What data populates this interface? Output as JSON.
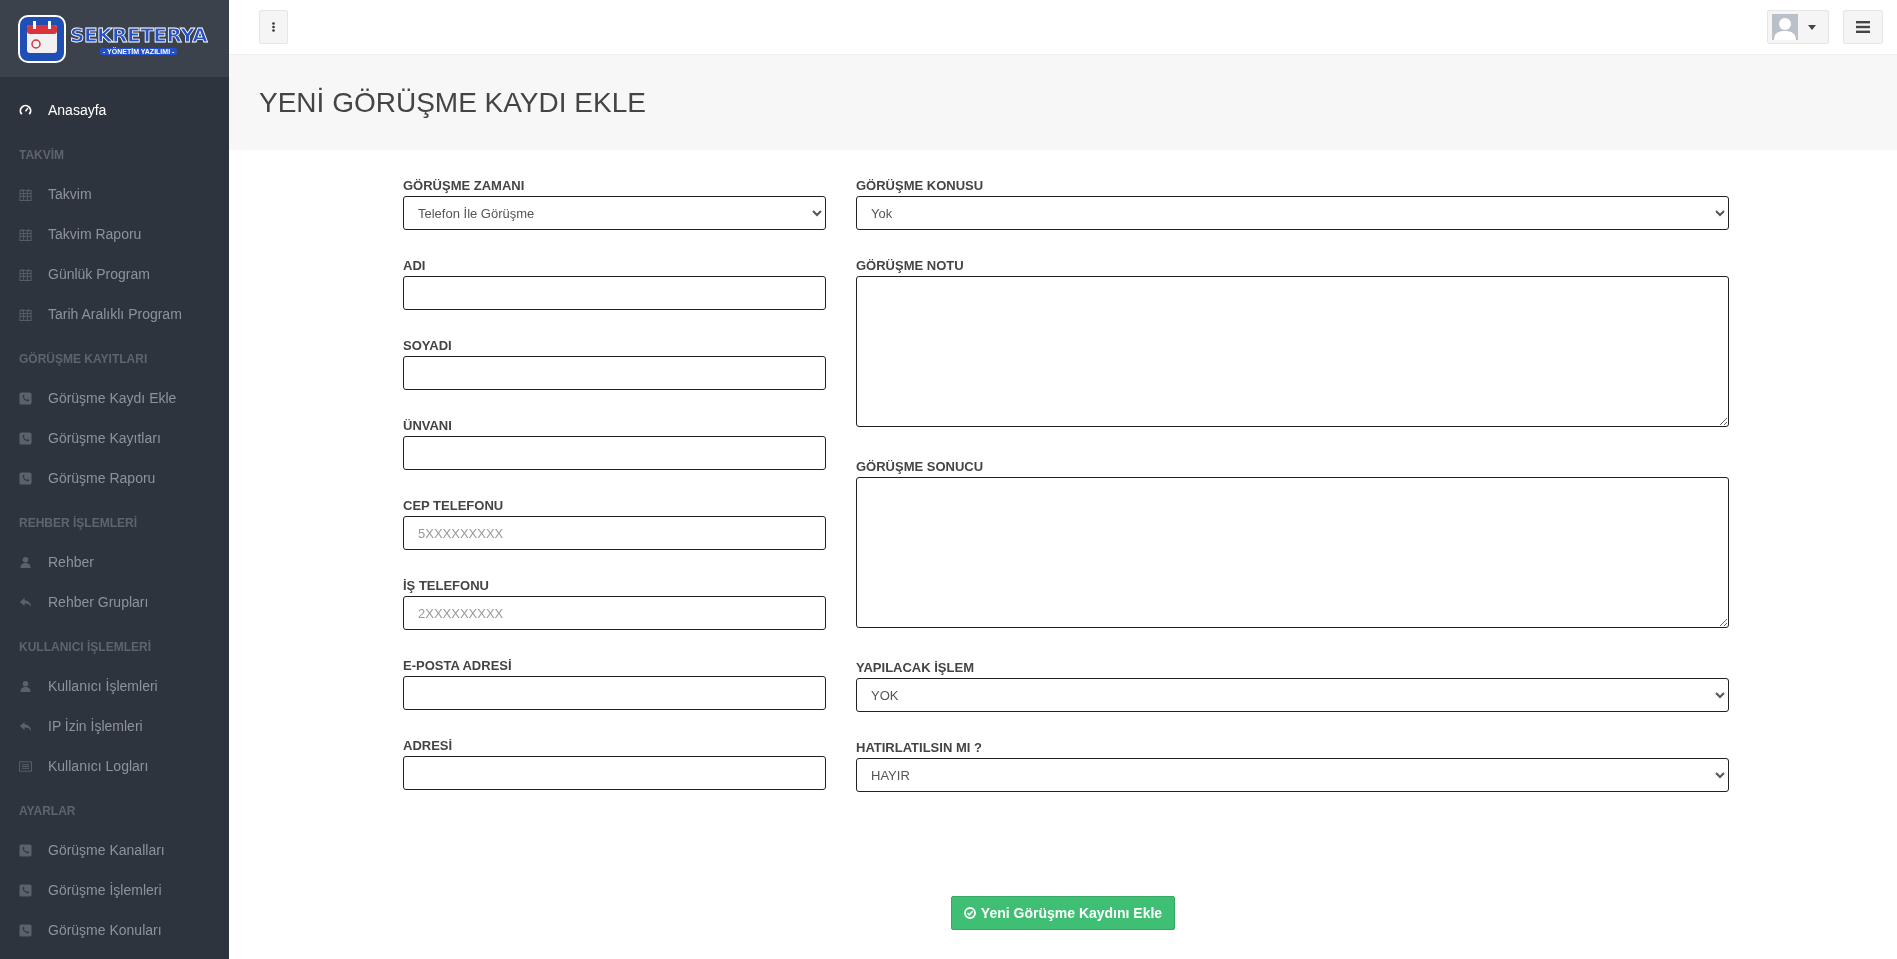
{
  "sidebar": {
    "logo": {
      "title": "SEKRETERYA",
      "subtitle": "- YÖNETİM YAZILIMI -"
    },
    "items": [
      {
        "kind": "dashboard",
        "label": "Anasayfa",
        "selected": true
      },
      {
        "kind": "heading",
        "label": "TAKVİM"
      },
      {
        "kind": "calendar",
        "label": "Takvim",
        "selected": false
      },
      {
        "kind": "calendar",
        "label": "Takvim Raporu",
        "selected": false
      },
      {
        "kind": "calendar",
        "label": "Günlük Program",
        "selected": false
      },
      {
        "kind": "calendar",
        "label": "Tarih Aralıklı Program",
        "selected": false
      },
      {
        "kind": "heading",
        "label": "GÖRÜŞME KAYITLARI"
      },
      {
        "kind": "call",
        "label": "Görüşme Kaydı Ekle",
        "selected": false
      },
      {
        "kind": "call",
        "label": "Görüşme Kayıtları",
        "selected": false
      },
      {
        "kind": "call",
        "label": "Görüşme Raporu",
        "selected": false
      },
      {
        "kind": "heading",
        "label": "REHBER İŞLEMLERİ"
      },
      {
        "kind": "contact",
        "label": "Rehber",
        "selected": false
      },
      {
        "kind": "share",
        "label": "Rehber Grupları",
        "selected": false
      },
      {
        "kind": "heading",
        "label": "KULLANICI İŞLEMLERİ"
      },
      {
        "kind": "contact",
        "label": "Kullanıcı İşlemleri",
        "selected": false
      },
      {
        "kind": "share",
        "label": "IP İzin İşlemleri",
        "selected": false
      },
      {
        "kind": "log",
        "label": "Kullanıcı Logları",
        "selected": false
      },
      {
        "kind": "heading",
        "label": "AYARLAR"
      },
      {
        "kind": "call",
        "label": "Görüşme Kanalları",
        "selected": false
      },
      {
        "kind": "call",
        "label": "Görüşme İşlemleri",
        "selected": false
      },
      {
        "kind": "call",
        "label": "Görüşme Konuları",
        "selected": false
      }
    ]
  },
  "page_title": "YENİ GÖRÜŞME KAYDI EKLE",
  "form": {
    "left": [
      {
        "label": "GÖRÜŞME ZAMANI",
        "kind": "select",
        "value": "Telefon İle Görüşme"
      },
      {
        "label": "ADI",
        "kind": "input"
      },
      {
        "label": "SOYADI",
        "kind": "input"
      },
      {
        "label": "ÜNVANI",
        "kind": "input"
      },
      {
        "label": "CEP TELEFONU",
        "kind": "input",
        "placeholder": "5XXXXXXXXX"
      },
      {
        "label": "İŞ TELEFONU",
        "kind": "input",
        "placeholder": "2XXXXXXXXX"
      },
      {
        "label": "E-POSTA ADRESİ",
        "kind": "input"
      },
      {
        "label": "ADRESİ",
        "kind": "input"
      }
    ],
    "right": [
      {
        "label": "GÖRÜŞME KONUSU",
        "kind": "select",
        "value": "Yok"
      },
      {
        "label": "GÖRÜŞME NOTU",
        "kind": "textarea"
      },
      {
        "label": "GÖRÜŞME SONUCU",
        "kind": "textarea"
      },
      {
        "label": "YAPILACAK İŞLEM",
        "kind": "select",
        "value": "YOK"
      },
      {
        "label": "HATIRLATILSIN MI ?",
        "kind": "select",
        "value": "HAYIR"
      }
    ],
    "submit": "Yeni Görüşme Kaydını Ekle"
  }
}
